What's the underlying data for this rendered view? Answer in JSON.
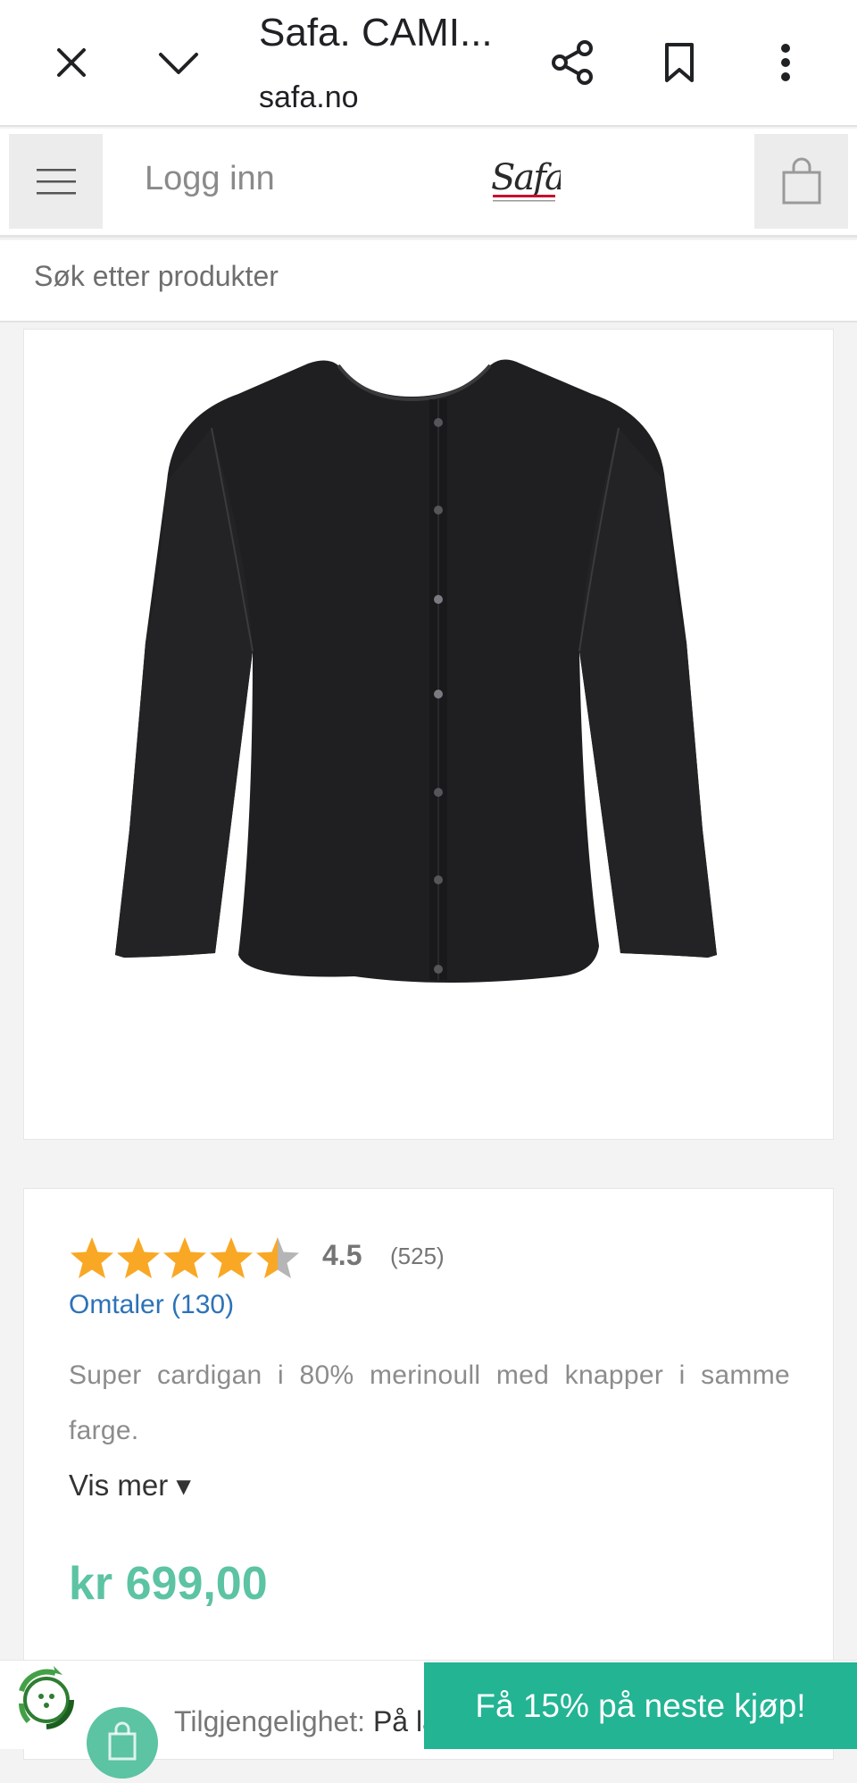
{
  "browser": {
    "title": "Safa. CAMI...",
    "url": "safa.no",
    "icons": [
      "close-icon",
      "chevron-down-icon",
      "share-icon",
      "bookmark-icon",
      "more-vertical-icon"
    ]
  },
  "site_header": {
    "login_label": "Logg inn",
    "logo_text": "Safa",
    "menu_icon": "hamburger-menu-icon",
    "cart_icon": "shopping-bag-icon"
  },
  "search": {
    "placeholder": "Søk etter produkter"
  },
  "product": {
    "image_alt": "Black button cardigan",
    "rating": {
      "stars": 4.5,
      "value_text": "4.5",
      "count_text": "(525)"
    },
    "reviews_link": "Omtaler (130)",
    "description": "Super cardigan i 80% merinoull med knapper i samme farge.",
    "show_more": "Vis mer ▾",
    "price": "kr 699,00"
  },
  "bottom": {
    "availability_label": "Tilgjengelighet:",
    "availability_value": "På la",
    "promo_label": "Få 15% på neste kjøp!"
  },
  "colors": {
    "accent": "#5cc3a3",
    "promo": "#22b493",
    "link": "#2d72b8",
    "star": "#f9a825"
  }
}
